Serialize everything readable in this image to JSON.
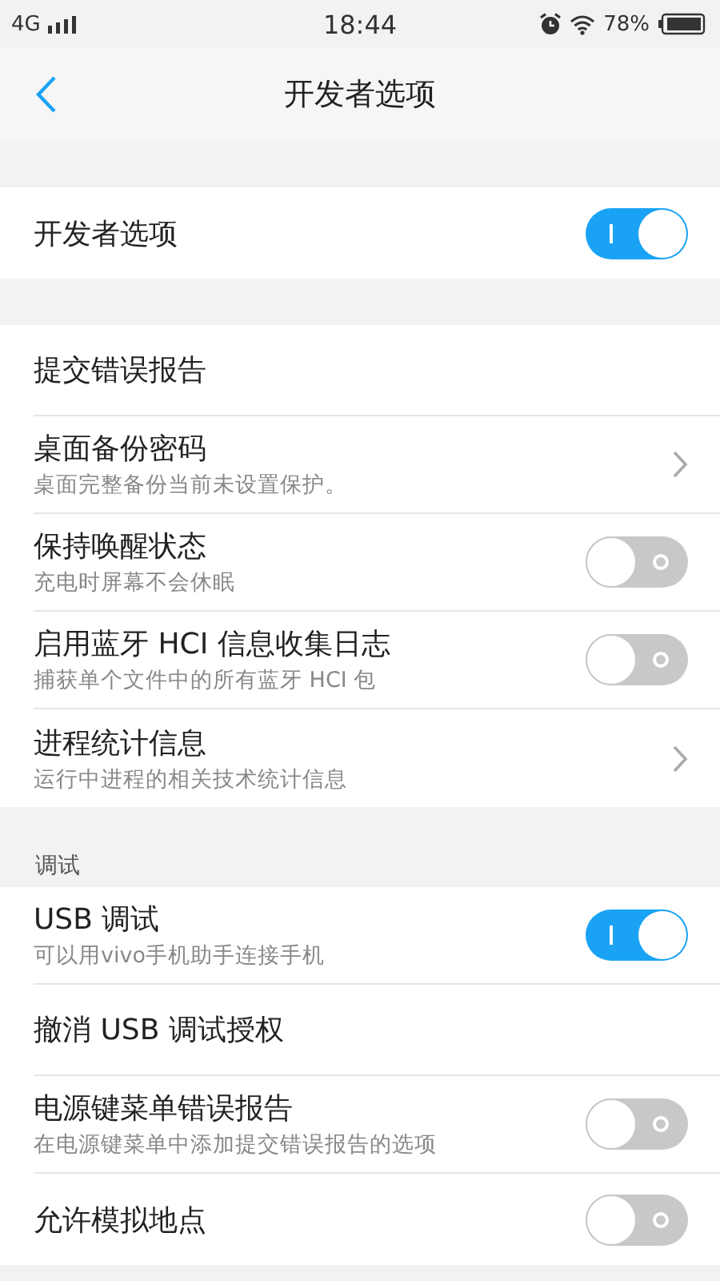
{
  "status_bar": {
    "network": "4G",
    "time": "18:44",
    "battery": "78%"
  },
  "header": {
    "title": "开发者选项"
  },
  "sections": [
    {
      "items": [
        {
          "kind": "toggle",
          "title": "开发者选项",
          "on": true
        }
      ]
    },
    {
      "items": [
        {
          "kind": "plain",
          "title": "提交错误报告"
        },
        {
          "kind": "link",
          "title": "桌面备份密码",
          "subtitle": "桌面完整备份当前未设置保护。"
        },
        {
          "kind": "toggle",
          "title": "保持唤醒状态",
          "subtitle": "充电时屏幕不会休眠",
          "on": false
        },
        {
          "kind": "toggle",
          "title": "启用蓝牙 HCI 信息收集日志",
          "subtitle": "捕获单个文件中的所有蓝牙 HCI 包",
          "on": false
        },
        {
          "kind": "link",
          "title": "进程统计信息",
          "subtitle": "运行中进程的相关技术统计信息"
        }
      ]
    },
    {
      "header": "调试",
      "items": [
        {
          "kind": "toggle",
          "title": "USB 调试",
          "subtitle": "可以用vivo手机助手连接手机",
          "on": true
        },
        {
          "kind": "plain",
          "title": "撤消 USB 调试授权"
        },
        {
          "kind": "toggle",
          "title": "电源键菜单错误报告",
          "subtitle": "在电源键菜单中添加提交错误报告的选项",
          "on": false
        },
        {
          "kind": "toggle",
          "title": "允许模拟地点",
          "on": false
        }
      ]
    }
  ]
}
